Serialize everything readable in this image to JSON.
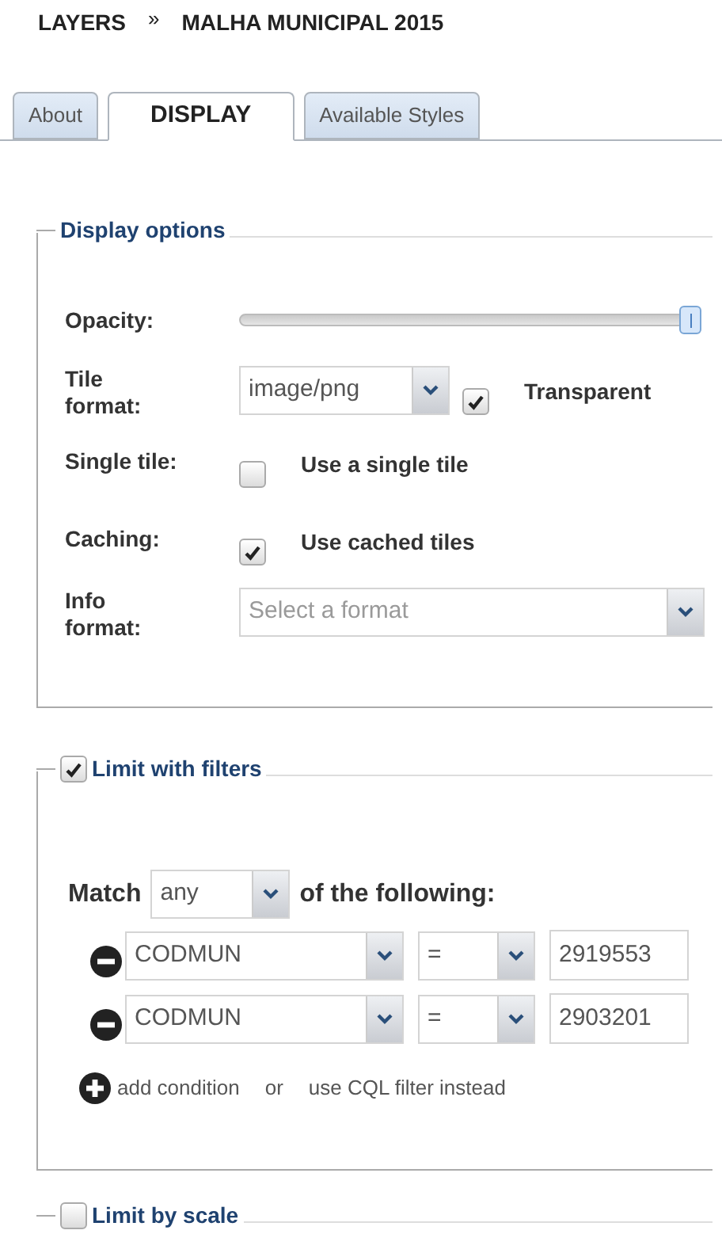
{
  "breadcrumb": {
    "parent": "LAYERS",
    "separator": "»",
    "current": "MALHA MUNICIPAL 2015"
  },
  "tabs": [
    {
      "label": "About",
      "selected": false
    },
    {
      "label": "DISPLAY",
      "selected": true
    },
    {
      "label": "Available Styles",
      "selected": false
    }
  ],
  "display_options": {
    "title": "Display options",
    "opacity": {
      "label": "Opacity:",
      "level": 1
    },
    "tile_format": {
      "label": "Tile format:",
      "value": "image/png",
      "transparent": {
        "checked": true,
        "label": "Transparent"
      }
    },
    "single_tile": {
      "label": "Single tile:",
      "checked": false,
      "text": "Use a single tile"
    },
    "caching": {
      "label": "Caching:",
      "checked": true,
      "text": "Use cached tiles"
    },
    "info_format": {
      "label": "Info format:",
      "placeholder": "Select a format"
    }
  },
  "filters": {
    "checked": true,
    "title": "Limit with filters",
    "match_label": "Match",
    "match_value": "any",
    "match_suffix": "of the following:",
    "conditions": [
      {
        "field": "CODMUN",
        "operator": "=",
        "value": "2919553"
      },
      {
        "field": "CODMUN",
        "operator": "=",
        "value": "2903201"
      }
    ],
    "add_label": "add condition",
    "or_text": "or",
    "cql_link": "use CQL filter instead"
  },
  "scale": {
    "checked": false,
    "title": "Limit by scale"
  }
}
